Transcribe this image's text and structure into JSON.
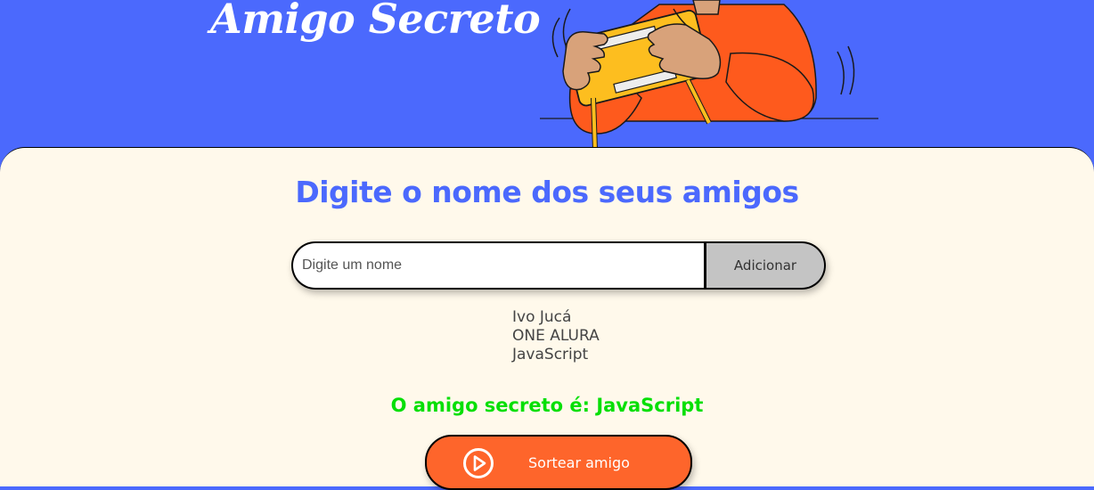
{
  "header": {
    "title": "Amigo Secreto",
    "illustration_icon": "person-playing-handheld-game-illustration"
  },
  "main": {
    "section_title": "Digite o nome dos seus amigos",
    "input": {
      "placeholder": "Digite um nome",
      "value": ""
    },
    "add_button_label": "Adicionar",
    "friends": [
      "Ivo Jucá",
      "ONE ALURA",
      "JavaScript"
    ],
    "result": "O amigo secreto é: JavaScript",
    "draw_button": {
      "label": "Sortear amigo",
      "icon": "play-circle-icon"
    }
  },
  "colors": {
    "header_bg": "#4B69FD",
    "main_bg": "#FFF9EB",
    "title_blue": "#4B69FD",
    "result_green": "#05DF05",
    "draw_button_orange": "#FE652B",
    "add_button_gray": "#C4C4C4"
  }
}
